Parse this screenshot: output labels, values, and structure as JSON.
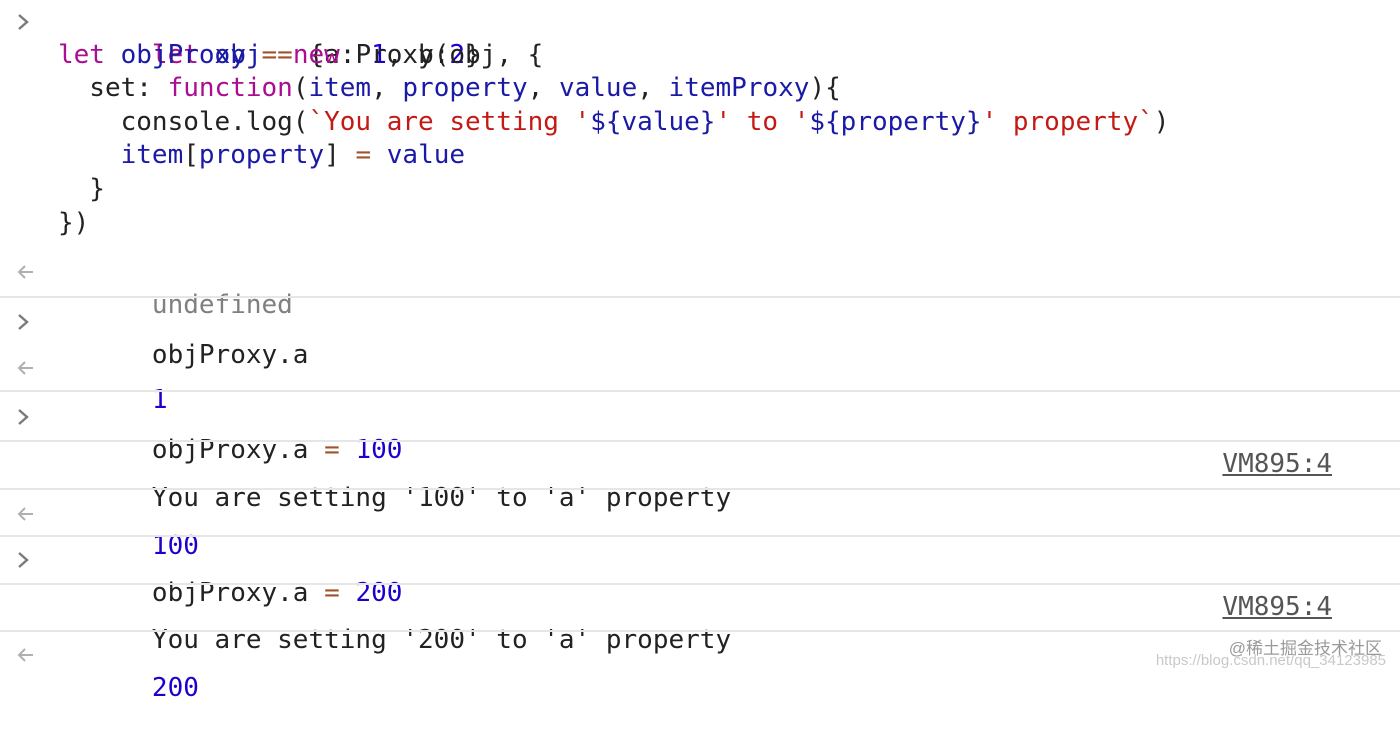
{
  "entry1": {
    "l1": {
      "t1": "let",
      "t2": " ",
      "t3": "obj",
      "t4": " ",
      "t5": "=",
      "t6": " {a: ",
      "t7": "1",
      "t8": ", b:",
      "t9": "2",
      "t10": "}"
    },
    "l2": {
      "t1": "let",
      "t2": " ",
      "t3": "objProxy",
      "t4": " ",
      "t5": "=",
      "t6": " ",
      "t7": "new",
      "t8": " Proxy(obj, {"
    },
    "l3": {
      "t1": "  set: ",
      "t2": "function",
      "t3": "(",
      "t4": "item",
      "t5": ", ",
      "t6": "property",
      "t7": ", ",
      "t8": "value",
      "t9": ", ",
      "t10": "itemProxy",
      "t11": "){"
    },
    "l4": {
      "t1": "    console.log(",
      "t2": "`You are setting '",
      "t3": "${value}",
      "t4": "' to '",
      "t5": "${property}",
      "t6": "' property`",
      "t7": ")"
    },
    "l5": {
      "t1": "    ",
      "t2": "item",
      "t3": "[",
      "t4": "property",
      "t5": "] ",
      "t6": "=",
      "t7": " ",
      "t8": "value"
    },
    "l6": "  }",
    "l7": "})",
    "result": "undefined"
  },
  "entry2": {
    "input": "objProxy.a",
    "result": "1"
  },
  "entry3": {
    "input_a": "objProxy.a",
    "input_op": " = ",
    "input_val": "100",
    "log": "You are setting '100' to 'a' property",
    "source": "VM895:4",
    "result": "100"
  },
  "entry4": {
    "input_a": "objProxy.a",
    "input_op": " = ",
    "input_val": "200",
    "log": "You are setting '200' to 'a' property",
    "source": "VM895:4",
    "result": "200"
  },
  "watermark": "@稀土掘金技术社区",
  "watermark_url": "https://blog.csdn.net/qq_34123985",
  "icons": {
    "input_prompt": "chevron-right-icon",
    "result_prompt": "return-arrow-icon"
  }
}
